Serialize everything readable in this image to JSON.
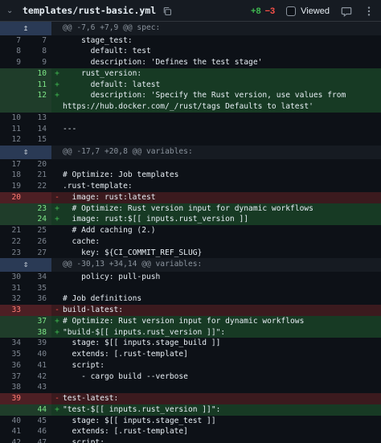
{
  "header": {
    "file_path": "templates/rust-basic.yml",
    "additions": "+8",
    "deletions": "−3",
    "viewed_label": "Viewed"
  },
  "colors": {
    "added": "#3fb950",
    "deleted": "#f85149",
    "hunk_bg": "#161b22",
    "bg": "#0d1117"
  },
  "hunks": [
    {
      "header": "@@ -7,6 +7,9 @@ spec:",
      "expand_icon": "expand-up-icon",
      "lines": [
        {
          "t": "ctx",
          "o": "7",
          "n": "7",
          "code": "    stage_test:"
        },
        {
          "t": "ctx",
          "o": "8",
          "n": "8",
          "code": "      default: test"
        },
        {
          "t": "ctx",
          "o": "9",
          "n": "9",
          "code": "      description: 'Defines the test stage'"
        },
        {
          "t": "add",
          "o": "",
          "n": "10",
          "code": "    rust_version:"
        },
        {
          "t": "add",
          "o": "",
          "n": "11",
          "code": "      default: latest"
        },
        {
          "t": "add",
          "o": "",
          "n": "12",
          "code": "      description: 'Specify the Rust version, use values from https://hub.docker.com/_/rust/tags Defaults to latest'"
        },
        {
          "t": "ctx",
          "o": "10",
          "n": "13",
          "code": ""
        },
        {
          "t": "ctx",
          "o": "11",
          "n": "14",
          "code": "---"
        },
        {
          "t": "ctx",
          "o": "12",
          "n": "15",
          "code": ""
        }
      ]
    },
    {
      "header": "@@ -17,7 +20,8 @@ variables:",
      "expand_icon": "expand-both-icon",
      "lines": [
        {
          "t": "ctx",
          "o": "17",
          "n": "20",
          "code": ""
        },
        {
          "t": "ctx",
          "o": "18",
          "n": "21",
          "code": "# Optimize: Job templates"
        },
        {
          "t": "ctx",
          "o": "19",
          "n": "22",
          "code": ".rust-template:"
        },
        {
          "t": "del",
          "o": "20",
          "n": "",
          "code": "  image: rust:latest"
        },
        {
          "t": "add",
          "o": "",
          "n": "23",
          "code": "  # Optimize: Rust version input for dynamic workflows"
        },
        {
          "t": "add",
          "o": "",
          "n": "24",
          "code": "  image: rust:$[[ inputs.rust_version ]]"
        },
        {
          "t": "ctx",
          "o": "21",
          "n": "25",
          "code": "  # Add caching (2.)"
        },
        {
          "t": "ctx",
          "o": "22",
          "n": "26",
          "code": "  cache:"
        },
        {
          "t": "ctx",
          "o": "23",
          "n": "27",
          "code": "    key: ${CI_COMMIT_REF_SLUG}"
        }
      ]
    },
    {
      "header": "@@ -30,13 +34,14 @@ variables:",
      "expand_icon": "expand-both-icon",
      "lines": [
        {
          "t": "ctx",
          "o": "30",
          "n": "34",
          "code": "    policy: pull-push"
        },
        {
          "t": "ctx",
          "o": "31",
          "n": "35",
          "code": ""
        },
        {
          "t": "ctx",
          "o": "32",
          "n": "36",
          "code": "# Job definitions"
        },
        {
          "t": "del",
          "o": "33",
          "n": "",
          "code": "build-latest:"
        },
        {
          "t": "add",
          "o": "",
          "n": "37",
          "code": "# Optimize: Rust version input for dynamic workflows"
        },
        {
          "t": "add",
          "o": "",
          "n": "38",
          "code": "\"build-$[[ inputs.rust_version ]]\":"
        },
        {
          "t": "ctx",
          "o": "34",
          "n": "39",
          "code": "  stage: $[[ inputs.stage_build ]]"
        },
        {
          "t": "ctx",
          "o": "35",
          "n": "40",
          "code": "  extends: [.rust-template]"
        },
        {
          "t": "ctx",
          "o": "36",
          "n": "41",
          "code": "  script:"
        },
        {
          "t": "ctx",
          "o": "37",
          "n": "42",
          "code": "    - cargo build --verbose"
        },
        {
          "t": "ctx",
          "o": "38",
          "n": "43",
          "code": ""
        },
        {
          "t": "del",
          "o": "39",
          "n": "",
          "code": "test-latest:"
        },
        {
          "t": "add",
          "o": "",
          "n": "44",
          "code": "\"test-$[[ inputs.rust_version ]]\":"
        },
        {
          "t": "ctx",
          "o": "40",
          "n": "45",
          "code": "  stage: $[[ inputs.stage_test ]]"
        },
        {
          "t": "ctx",
          "o": "41",
          "n": "46",
          "code": "  extends: [.rust-template]"
        },
        {
          "t": "ctx",
          "o": "42",
          "n": "47",
          "code": "  script:"
        }
      ]
    }
  ]
}
